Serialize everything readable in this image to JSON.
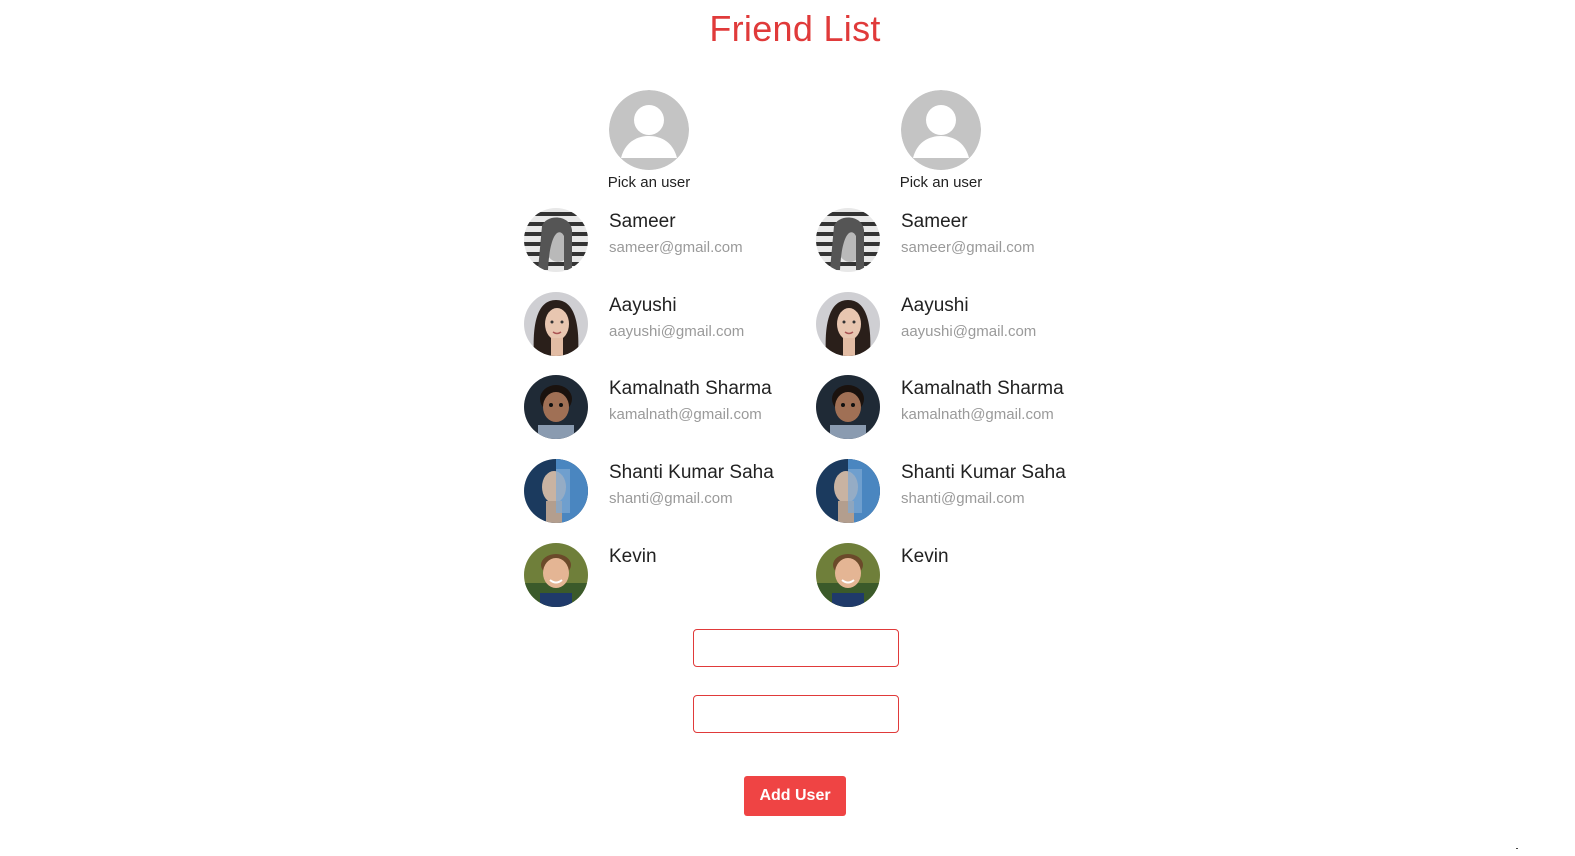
{
  "page": {
    "title": "Friend List"
  },
  "pickers": [
    {
      "label": "Pick an user",
      "icon": "user-placeholder-icon"
    },
    {
      "label": "Pick an user",
      "icon": "user-placeholder-icon"
    }
  ],
  "friends_left": [
    {
      "name": "Sameer",
      "email": "sameer@gmail.com"
    },
    {
      "name": "Aayushi",
      "email": "aayushi@gmail.com"
    },
    {
      "name": "Kamalnath Sharma",
      "email": "kamalnath@gmail.com"
    },
    {
      "name": "Shanti Kumar Saha",
      "email": "shanti@gmail.com"
    },
    {
      "name": "Kevin",
      "email": ""
    }
  ],
  "friends_right": [
    {
      "name": "Sameer",
      "email": "sameer@gmail.com"
    },
    {
      "name": "Aayushi",
      "email": "aayushi@gmail.com"
    },
    {
      "name": "Kamalnath Sharma",
      "email": "kamalnath@gmail.com"
    },
    {
      "name": "Shanti Kumar Saha",
      "email": "shanti@gmail.com"
    },
    {
      "name": "Kevin",
      "email": ""
    }
  ],
  "form": {
    "name_value": "",
    "name_placeholder": "",
    "email_value": "",
    "email_placeholder": "",
    "submit_label": "Add User"
  },
  "colors": {
    "accent": "#e03a3a",
    "button": "#ef4444",
    "muted_text": "#9a9a9a",
    "placeholder_avatar": "#c4c4c4"
  }
}
